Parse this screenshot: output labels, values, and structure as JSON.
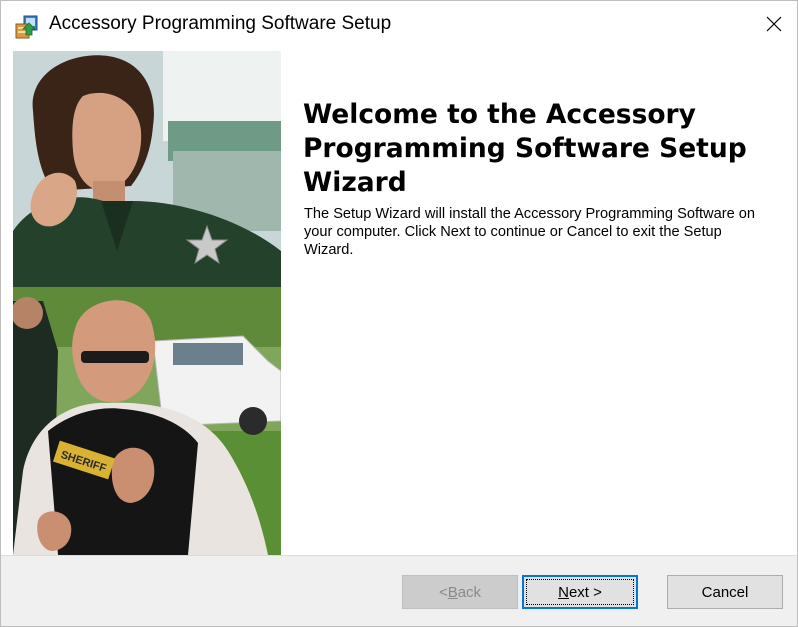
{
  "window": {
    "title": "Accessory Programming Software Setup",
    "icon": "installer-icon",
    "close_glyph": "✕"
  },
  "welcome": {
    "heading": "Welcome to the Accessory Programming Software Setup Wizard",
    "body": "The Setup Wizard will install the Accessory Programming Software on your computer. Click Next to continue or Cancel to exit the Setup Wizard."
  },
  "photo": {
    "badge_text": "SHERIFF"
  },
  "buttons": {
    "back_prefix": "< ",
    "back_accel": "B",
    "back_rest": "ack",
    "back_enabled": false,
    "next_accel": "N",
    "next_rest": "ext >",
    "cancel": "Cancel"
  },
  "colors": {
    "focus_border": "#0078d7",
    "footer_bg": "#f0f0f0",
    "uniform_green": "#24412c"
  }
}
